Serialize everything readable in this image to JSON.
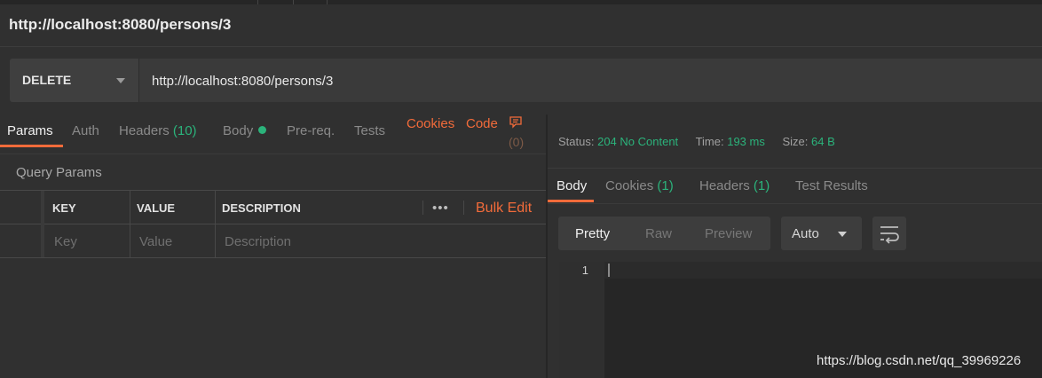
{
  "request": {
    "title": "http://localhost:8080/persons/3",
    "method": "DELETE",
    "url": "http://localhost:8080/persons/3"
  },
  "request_tabs": {
    "params": "Params",
    "auth": "Auth",
    "headers": "Headers",
    "headers_count": "(10)",
    "body": "Body",
    "prereq": "Pre-req.",
    "tests": "Tests",
    "cookies": "Cookies",
    "code": "Code",
    "comments_count": "(0)"
  },
  "query_params": {
    "title": "Query Params",
    "columns": {
      "key": "KEY",
      "value": "VALUE",
      "description": "DESCRIPTION"
    },
    "more": "•••",
    "bulk_edit": "Bulk Edit",
    "placeholders": {
      "key": "Key",
      "value": "Value",
      "description": "Description"
    }
  },
  "response": {
    "status_label": "Status:",
    "status_value": "204 No Content",
    "time_label": "Time:",
    "time_value": "193 ms",
    "size_label": "Size:",
    "size_value": "64 B",
    "tabs": {
      "body": "Body",
      "cookies": "Cookies",
      "cookies_count": "(1)",
      "headers": "Headers",
      "headers_count": "(1)",
      "tests": "Test Results"
    },
    "view": {
      "pretty": "Pretty",
      "raw": "Raw",
      "preview": "Preview",
      "format": "Auto"
    },
    "editor": {
      "line_number": "1"
    }
  },
  "watermark": "https://blog.csdn.net/qq_39969226",
  "colors": {
    "accent": "#f26b3a",
    "status_green": "#2bb37b",
    "background": "#303030"
  },
  "icons": [
    "chevron-down-icon",
    "comment-icon",
    "wrap-lines-icon"
  ]
}
